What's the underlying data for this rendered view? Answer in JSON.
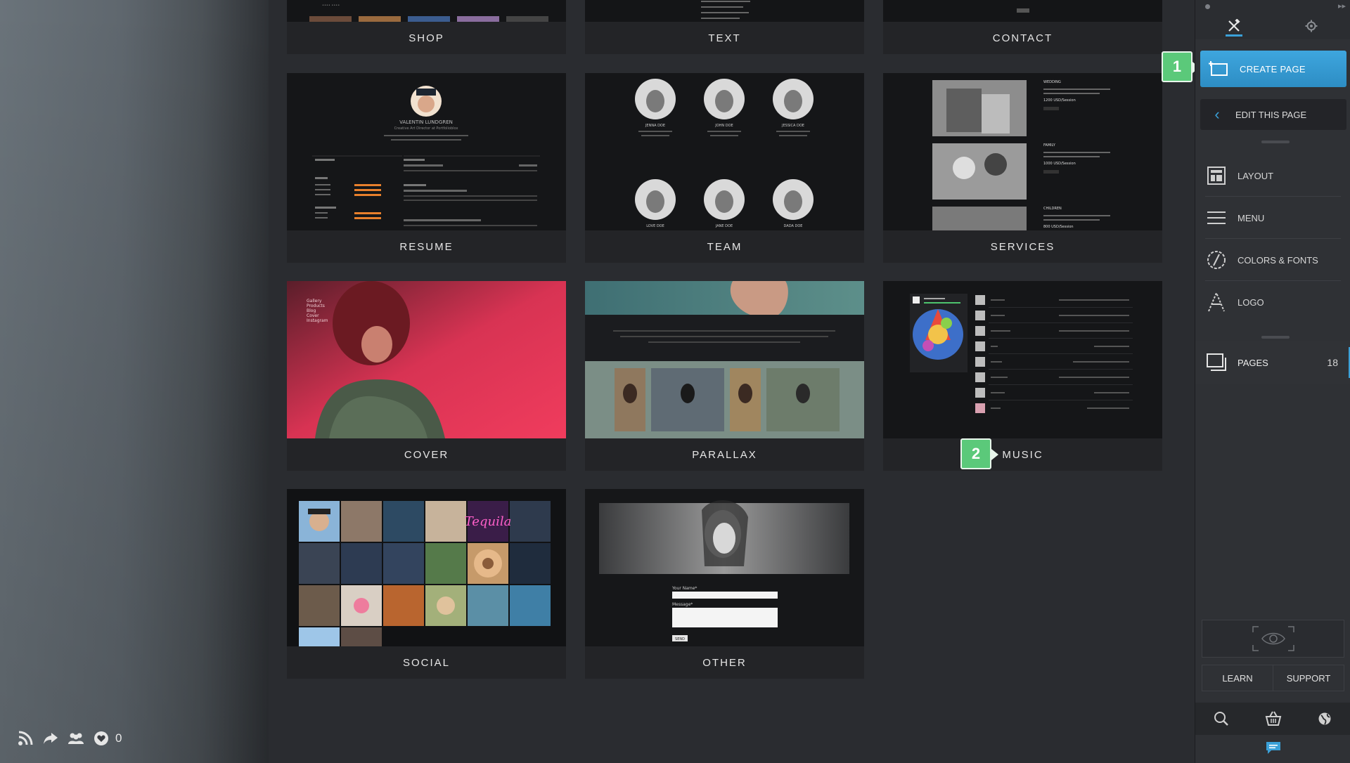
{
  "social": {
    "like_count": "0"
  },
  "templates": [
    {
      "id": "shop",
      "label": "SHOP"
    },
    {
      "id": "text",
      "label": "TEXT"
    },
    {
      "id": "contact",
      "label": "CONTACT"
    },
    {
      "id": "resume",
      "label": "RESUME",
      "name": "VALENTIN LUNDGREN",
      "role": "Creative Art Director at Portfolioblox"
    },
    {
      "id": "team",
      "label": "TEAM",
      "members": [
        "JENNA DOE",
        "JOHN DOE",
        "JESSICA DOE",
        "LOVE DOE",
        "JANE DOE",
        "DADA DOE"
      ]
    },
    {
      "id": "services",
      "label": "SERVICES",
      "items": [
        "WEDDING",
        "FAMILY",
        "CHILDREN"
      ],
      "prices": [
        "1200 USD/Session",
        "1000 USD/Session",
        "800 USD/Session"
      ]
    },
    {
      "id": "cover",
      "label": "COVER",
      "menu": [
        "Gallery",
        "Products",
        "Blog",
        "Cover",
        "Instagram"
      ]
    },
    {
      "id": "parallax",
      "label": "PARALLAX"
    },
    {
      "id": "music",
      "label": "MUSIC"
    },
    {
      "id": "social",
      "label": "SOCIAL"
    },
    {
      "id": "other",
      "label": "OTHER",
      "field1": "Your Name*",
      "field2": "Message*",
      "send": "SEND"
    }
  ],
  "sidebar": {
    "create_page": "CREATE PAGE",
    "edit_this_page": "EDIT THIS PAGE",
    "items": [
      {
        "label": "LAYOUT",
        "icon": "layout-icon"
      },
      {
        "label": "MENU",
        "icon": "menu-icon"
      },
      {
        "label": "COLORS & FONTS",
        "icon": "palette-icon"
      },
      {
        "label": "LOGO",
        "icon": "logo-icon"
      }
    ],
    "pages": {
      "label": "PAGES",
      "count": "18"
    },
    "learn": "LEARN",
    "support": "SUPPORT"
  },
  "callouts": [
    "1",
    "2"
  ],
  "colors": {
    "accent": "#3aa0d8",
    "callout": "#5bc97a",
    "bg": "#2a2c30"
  }
}
